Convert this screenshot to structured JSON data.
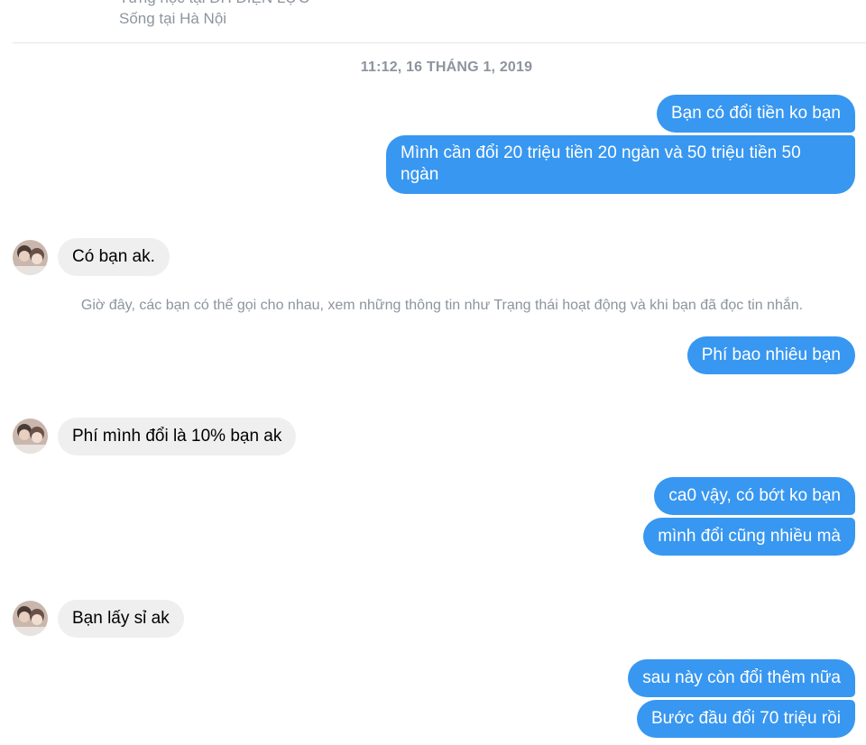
{
  "profile": {
    "studied_at": "Từng học tại ĐH ĐIỆN LỰC",
    "lives_in": "Sống tại Hà Nội"
  },
  "timestamp": "11:12, 16 THÁNG 1, 2019",
  "system_note": "Giờ đây, các bạn có thể gọi cho nhau, xem những thông tin như Trạng thái hoạt động và khi bạn đã đọc tin nhắn.",
  "messages": [
    {
      "direction": "outgoing",
      "text": "Bạn có đổi tiền ko bạn"
    },
    {
      "direction": "outgoing",
      "text": "Mình cần đổi 20 triệu tiền 20 ngàn và 50 triệu tiền 50 ngàn"
    },
    {
      "direction": "incoming",
      "text": "Có bạn ak."
    },
    {
      "direction": "outgoing",
      "text": "Phí bao nhiêu bạn"
    },
    {
      "direction": "incoming",
      "text": "Phí mình đổi là 10% bạn ak"
    },
    {
      "direction": "outgoing",
      "text": "ca0 vậy, có bớt ko bạn"
    },
    {
      "direction": "outgoing",
      "text": "mình đổi cũng nhiều mà"
    },
    {
      "direction": "incoming",
      "text": "Bạn lấy sỉ ak"
    },
    {
      "direction": "outgoing",
      "text": "sau này còn đổi thêm nữa"
    },
    {
      "direction": "outgoing",
      "text": "Bước đầu đổi 70 triệu rồi"
    }
  ],
  "colors": {
    "outgoing_bubble": "#3897f0",
    "incoming_bubble": "#efefef",
    "meta_text": "#8d949e"
  },
  "icons": {
    "avatar": "contact-avatar-icon"
  }
}
